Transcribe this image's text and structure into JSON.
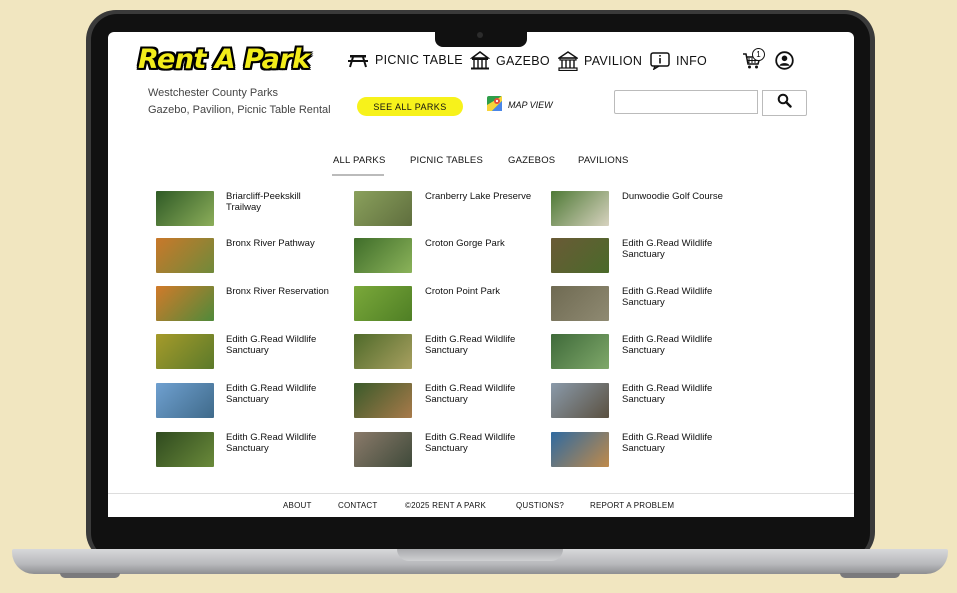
{
  "app": {
    "logo": "Rent A Park",
    "nav": [
      {
        "label": "PICNIC TABLE",
        "icon": "picnic-table-icon"
      },
      {
        "label": "GAZEBO",
        "icon": "gazebo-icon"
      },
      {
        "label": "PAVILION",
        "icon": "pavilion-icon"
      },
      {
        "label": "INFO",
        "icon": "info-icon"
      }
    ],
    "cart_count": "1"
  },
  "header": {
    "subtitle_line1": "Westchester County Parks",
    "subtitle_line2": "Gazebo, Pavilion, Picnic Table Rental",
    "see_all_label": "SEE ALL PARKS",
    "map_view_label": "MAP VIEW",
    "search_placeholder": ""
  },
  "tabs": [
    "ALL PARKS",
    "PICNIC TABLES",
    "GAZEBOS",
    "PAVILIONS"
  ],
  "active_tab": "ALL PARKS",
  "parks": [
    {
      "name": "Briarcliff-Peekskill Trailway",
      "colors": [
        "#2f5a26",
        "#8cae5a"
      ]
    },
    {
      "name": "Cranberry Lake Preserve",
      "colors": [
        "#8aa05c",
        "#5f6e3e"
      ]
    },
    {
      "name": "Dunwoodie Golf Course",
      "colors": [
        "#4f7a36",
        "#d7d2bf"
      ]
    },
    {
      "name": "Bronx River Pathway",
      "colors": [
        "#c9782a",
        "#6f8a3a"
      ]
    },
    {
      "name": "Croton Gorge Park",
      "colors": [
        "#3f6d2a",
        "#8bb35a"
      ]
    },
    {
      "name": "Edith G.Read Wildlife Sanctuary",
      "colors": [
        "#6a5a36",
        "#4a6a2a"
      ]
    },
    {
      "name": "Bronx River Reservation",
      "colors": [
        "#d17a2a",
        "#4f8a3a"
      ]
    },
    {
      "name": "Croton Point Park",
      "colors": [
        "#7aa83a",
        "#4f7f25"
      ]
    },
    {
      "name": "Edith G.Read Wildlife Sanctuary",
      "colors": [
        "#6f6a52",
        "#8f8a72"
      ]
    },
    {
      "name": "Edith G.Read Wildlife Sanctuary",
      "colors": [
        "#a59a2a",
        "#5b7a2a"
      ]
    },
    {
      "name": "Edith G.Read Wildlife Sanctuary",
      "colors": [
        "#4f6a2a",
        "#a8a060"
      ]
    },
    {
      "name": "Edith G.Read Wildlife Sanctuary",
      "colors": [
        "#3f6a3a",
        "#7fa86a"
      ]
    },
    {
      "name": "Edith G.Read Wildlife Sanctuary",
      "colors": [
        "#6fa0d0",
        "#3f6a8a"
      ]
    },
    {
      "name": "Edith G.Read Wildlife Sanctuary",
      "colors": [
        "#3a5a2a",
        "#a87a4a"
      ]
    },
    {
      "name": "Edith G.Read Wildlife Sanctuary",
      "colors": [
        "#8a9aaa",
        "#5a5040"
      ]
    },
    {
      "name": "Edith G.Read Wildlife Sanctuary",
      "colors": [
        "#2f4a1f",
        "#6a8a3a"
      ]
    },
    {
      "name": "Edith G.Read Wildlife Sanctuary",
      "colors": [
        "#8a7a6a",
        "#3f4a3a"
      ]
    },
    {
      "name": "Edith G.Read Wildlife Sanctuary",
      "colors": [
        "#2f6aa0",
        "#c08a4a"
      ]
    }
  ],
  "footer": [
    "ABOUT",
    "CONTACT",
    "©2025 RENT A PARK",
    "QUSTIONS?",
    "REPORT A PROBLEM"
  ]
}
